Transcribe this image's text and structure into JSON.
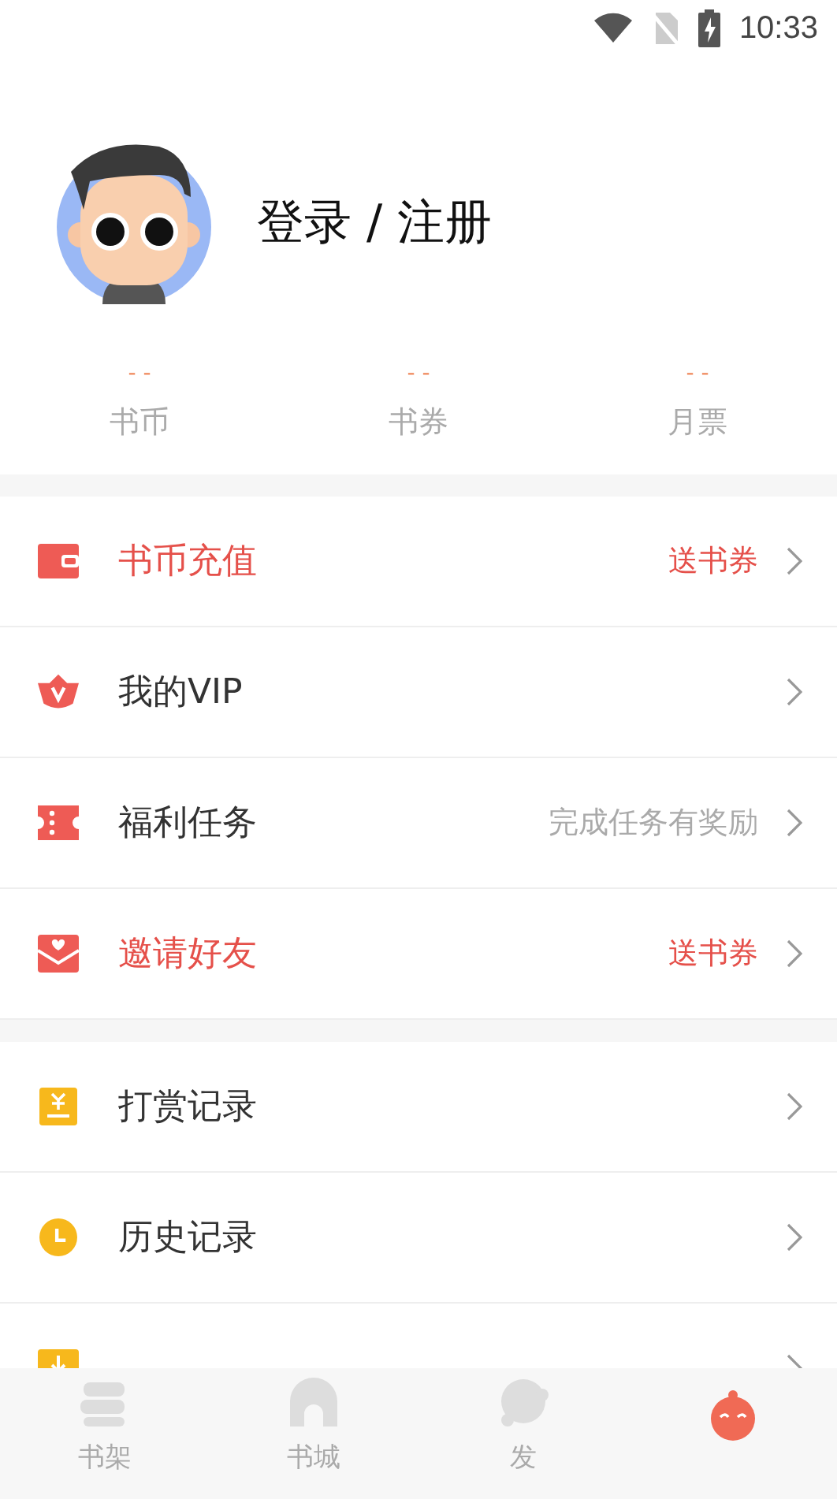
{
  "status_bar": {
    "time": "10:33"
  },
  "profile": {
    "login_label": "登录 / 注册"
  },
  "stats": [
    {
      "value": "- -",
      "label": "书币"
    },
    {
      "value": "- -",
      "label": "书券"
    },
    {
      "value": "- -",
      "label": "月票"
    }
  ],
  "menu_groups": [
    {
      "items": [
        {
          "kind": "wallet",
          "label": "书币充值",
          "hint": "送书券",
          "highlight": true
        },
        {
          "kind": "crown",
          "label": "我的VIP",
          "highlight": false
        },
        {
          "kind": "ticket",
          "label": "福利任务",
          "hint": "完成任务有奖励",
          "highlight": false
        },
        {
          "kind": "envelope",
          "label": "邀请好友",
          "hint": "送书券",
          "highlight": true
        }
      ]
    },
    {
      "items": [
        {
          "kind": "reward",
          "highlight": false,
          "label": "打赏记录"
        },
        {
          "kind": "clock",
          "highlight": false,
          "label": "历史记录"
        },
        {
          "kind": "download"
        }
      ]
    }
  ],
  "tab_bar": [
    {
      "kind": "shelf",
      "label": "书架",
      "selected": false
    },
    {
      "kind": "store",
      "label": "书城",
      "selected": false
    },
    {
      "kind": "discover",
      "label": "发",
      "selected": false
    },
    {
      "kind": "me",
      "selected": true
    }
  ]
}
